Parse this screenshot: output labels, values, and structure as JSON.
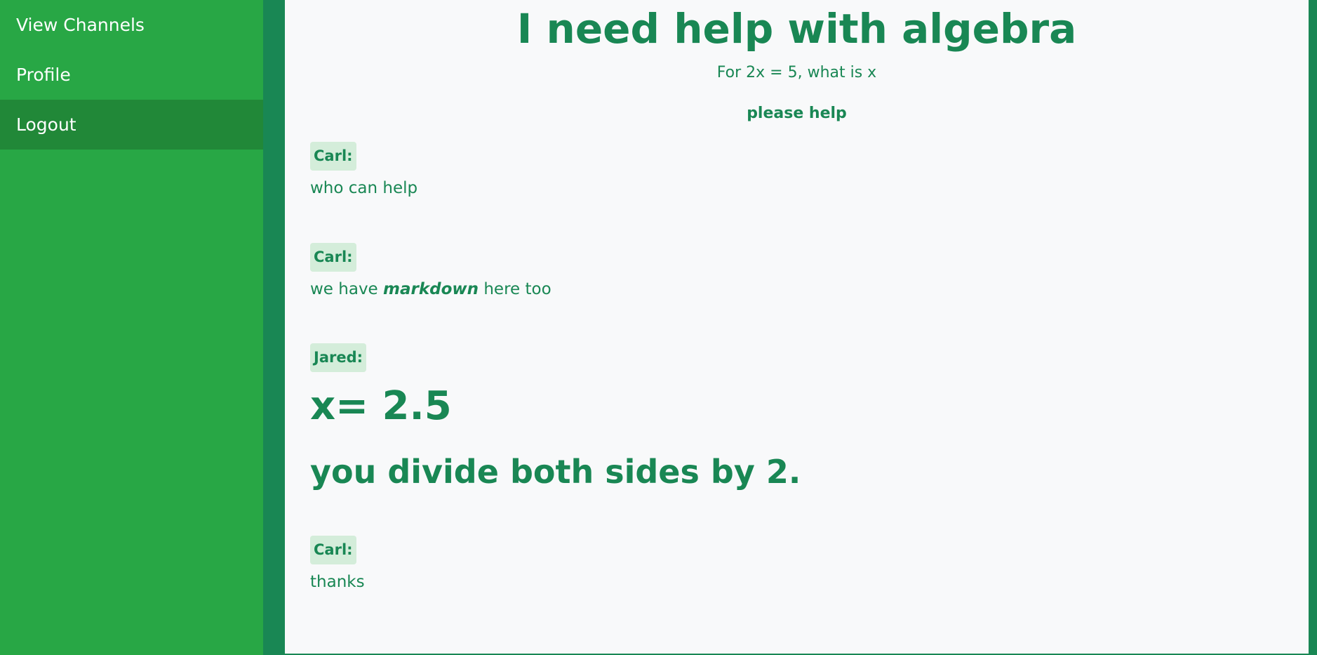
{
  "sidebar": {
    "items": [
      {
        "label": "View Channels"
      },
      {
        "label": "Profile"
      },
      {
        "label": "Logout"
      }
    ]
  },
  "channel": {
    "title": "I need help with algebra",
    "description": "For 2x = 5, what is x",
    "note": "please help"
  },
  "messages": [
    {
      "author": "Carl:",
      "text": "who can help"
    },
    {
      "author": "Carl:",
      "text_before": "we have ",
      "emphasis": "markdown",
      "text_after": " here too"
    },
    {
      "author": "Jared:",
      "heading1": "x=  2.5",
      "heading2": "you divide both sides by 2."
    },
    {
      "author": "Carl:",
      "text": "thanks"
    }
  ],
  "colors": {
    "sidebar_bg": "#28a745",
    "sidebar_active_bg": "#218838",
    "accent": "#198754",
    "content_bg": "#f8f9fa",
    "author_badge_bg": "#d4edda"
  }
}
